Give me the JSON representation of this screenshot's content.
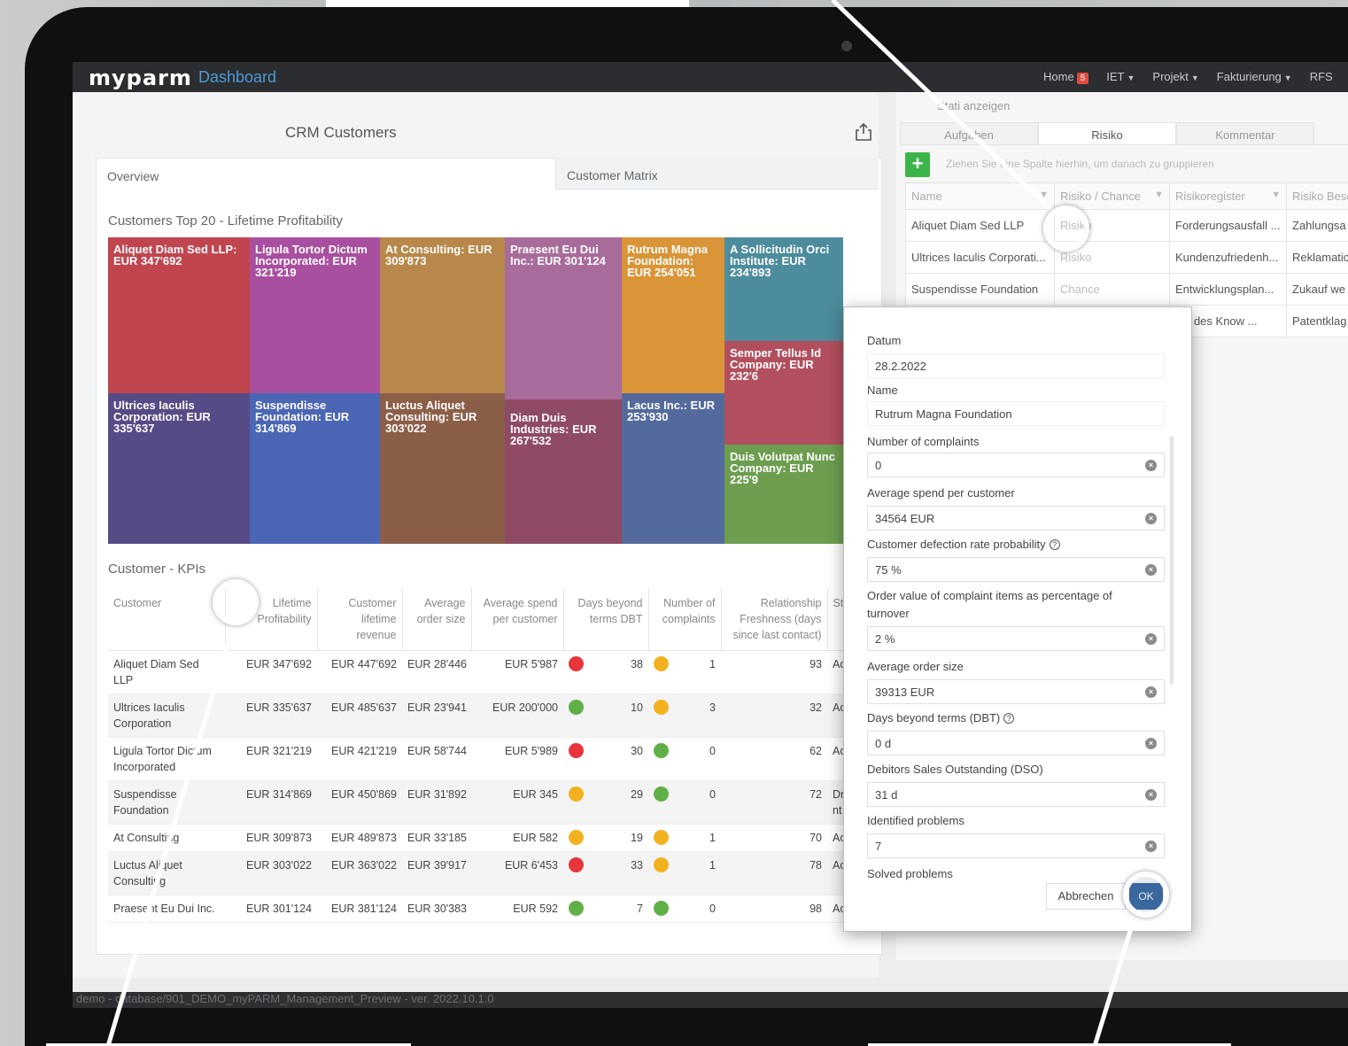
{
  "navbar": {
    "logo": "myparm",
    "subtitle": "Dashboard",
    "menu": [
      {
        "label": "Home",
        "badge": "5"
      },
      {
        "label": "IET",
        "caret": true
      },
      {
        "label": "Projekt",
        "caret": true
      },
      {
        "label": "Fakturierung",
        "caret": true
      },
      {
        "label": "RFS"
      }
    ]
  },
  "left": {
    "title": "CRM Customers",
    "tabs": [
      "Overview",
      "Customer Matrix"
    ],
    "treemap_title": "Customers Top 20 - Lifetime Profitability",
    "treemap": [
      {
        "label": "Aliquet Diam Sed LLP: EUR 347'692",
        "color": "#c0454f"
      },
      {
        "label": "Ligula Tortor Dictum Incorporated: EUR 321'219",
        "color": "#a94f9f"
      },
      {
        "label": "At Consulting: EUR 309'873",
        "color": "#b7884a"
      },
      {
        "label": "Praesent Eu Dui Inc.: EUR 301'124",
        "color": "#a86c9b"
      },
      {
        "label": "Rutrum Magna Foundation: EUR 254'051",
        "color": "#d99538"
      },
      {
        "label": "A Sollicitudin Orci Institute: EUR 234'893",
        "color": "#4d8c9c"
      },
      {
        "label": "Semper Tellus Id Company: EUR 232'6",
        "color": "#b24f5e"
      },
      {
        "label": "Ultrices Iaculis Corporation: EUR 335'637",
        "color": "#574b87"
      },
      {
        "label": "Suspendisse Foundation: EUR 314'869",
        "color": "#4a66b5"
      },
      {
        "label": "Luctus Aliquet Consulting: EUR 303'022",
        "color": "#8b5e48"
      },
      {
        "label": "Diam Duis Industries: EUR 267'532",
        "color": "#8f4a66"
      },
      {
        "label": "Lacus Inc.: EUR 253'930",
        "color": "#556a9c"
      },
      {
        "label": "Duis Volutpat Nunc Company: EUR 225'9",
        "color": "#6d9e4f"
      }
    ],
    "kpi_title": "Customer - KPIs",
    "kpi_columns": [
      "Customer",
      "Lifetime Profitability",
      "Customer lifetime revenue",
      "Average order size",
      "Average spend per customer",
      "Days beyond terms DBT",
      "Number of complaints",
      "Relationship Freshness (days since last contact)",
      "St"
    ],
    "kpi_rows": [
      {
        "customer": "Aliquet Diam Sed LLP",
        "lp": "EUR 347'692",
        "clr": "EUR 447'692",
        "aos": "EUR 28'446",
        "asp": "EUR 5'987",
        "dbt_color": "#e8343b",
        "dbt": "38",
        "nc_color": "#f2b21f",
        "nc": "1",
        "rf": "93",
        "st": "Ac"
      },
      {
        "customer": "Ultrices Iaculis Corporation",
        "lp": "EUR 335'637",
        "clr": "EUR 485'637",
        "aos": "EUR 23'941",
        "asp": "EUR 200'000",
        "dbt_color": "#5fb046",
        "dbt": "10",
        "nc_color": "#f2b21f",
        "nc": "3",
        "rf": "32",
        "st": "Ac"
      },
      {
        "customer": "Ligula Tortor Dictum Incorporated",
        "lp": "EUR 321'219",
        "clr": "EUR 421'219",
        "aos": "EUR 58'744",
        "asp": "EUR 5'989",
        "dbt_color": "#e8343b",
        "dbt": "30",
        "nc_color": "#5fb046",
        "nc": "0",
        "rf": "62",
        "st": "Ac"
      },
      {
        "customer": "Suspendisse Foundation",
        "lp": "EUR 314'869",
        "clr": "EUR 450'869",
        "aos": "EUR 31'892",
        "asp": "EUR 345",
        "dbt_color": "#f2b21f",
        "dbt": "29",
        "nc_color": "#5fb046",
        "nc": "0",
        "rf": "72",
        "st": "Dr nt"
      },
      {
        "customer": "At Consulting",
        "lp": "EUR 309'873",
        "clr": "EUR 489'873",
        "aos": "EUR 33'185",
        "asp": "EUR 582",
        "dbt_color": "#f2b21f",
        "dbt": "19",
        "nc_color": "#f2b21f",
        "nc": "1",
        "rf": "70",
        "st": "Ac"
      },
      {
        "customer": "Luctus Aliquet Consulting",
        "lp": "EUR 303'022",
        "clr": "EUR 363'022",
        "aos": "EUR 39'917",
        "asp": "EUR 6'453",
        "dbt_color": "#e8343b",
        "dbt": "33",
        "nc_color": "#f2b21f",
        "nc": "1",
        "rf": "78",
        "st": "Ac"
      },
      {
        "customer": "Praesent Eu Dui Inc.",
        "lp": "EUR 301'124",
        "clr": "EUR 381'124",
        "aos": "EUR 30'383",
        "asp": "EUR 592",
        "dbt_color": "#5fb046",
        "dbt": "7",
        "nc_color": "#5fb046",
        "nc": "0",
        "rf": "98",
        "st": "Ac"
      }
    ]
  },
  "right": {
    "stati": "Stati anzeigen",
    "tabs": [
      "Aufgaben",
      "Risiko",
      "Kommentar"
    ],
    "group_hint": "Ziehen Sie eine Spalte hierhin, um danach zu gruppieren",
    "columns": [
      "Name",
      "Risiko / Chance",
      "Risikoregister",
      "Risiko Besc"
    ],
    "rows": [
      {
        "name": "Aliquet Diam Sed LLP",
        "rc": "Risiko",
        "reg": "Forderungsausfall ...",
        "desc": "Zahlungsa"
      },
      {
        "name": "Ultrices Iaculis Corporati...",
        "rc": "Risiko",
        "reg": "Kundenzufriedenh...",
        "desc": "Reklamatic"
      },
      {
        "name": "Suspendisse Foundation",
        "rc": "Chance",
        "reg": "Entwicklungsplan...",
        "desc": "Zukauf we"
      },
      {
        "name": "",
        "rc": "",
        "reg": "utz des Know ...",
        "desc": "Patentklag"
      }
    ]
  },
  "dialog": {
    "fields": [
      {
        "label": "Datum",
        "value": "28.2.2022",
        "clear": false
      },
      {
        "label": "Name",
        "value": "Rutrum Magna Foundation",
        "clear": false
      },
      {
        "label": "Number of complaints",
        "value": "0",
        "clear": true
      },
      {
        "label": "Average spend per customer",
        "value": "34564 EUR",
        "clear": true
      },
      {
        "label": "Customer defection rate probability",
        "value": "75 %",
        "clear": true,
        "help": true
      },
      {
        "label": "Order value of complaint items as percentage of turnover",
        "value": "2 %",
        "clear": true
      },
      {
        "label": "Average order size",
        "value": "39313 EUR",
        "clear": true
      },
      {
        "label": "Days beyond terms (DBT)",
        "value": "0 d",
        "clear": true,
        "help": true
      },
      {
        "label": "Debitors Sales Outstanding (DSO)",
        "value": "31 d",
        "clear": true
      },
      {
        "label": "Identified problems",
        "value": "7",
        "clear": true
      },
      {
        "label": "Solved problems",
        "value": "",
        "clear": false
      }
    ],
    "cancel": "Abbrechen",
    "ok": "OK"
  },
  "footer": "demo - database/901_DEMO_myPARM_Management_Preview - ver. 2022.10.1.0"
}
